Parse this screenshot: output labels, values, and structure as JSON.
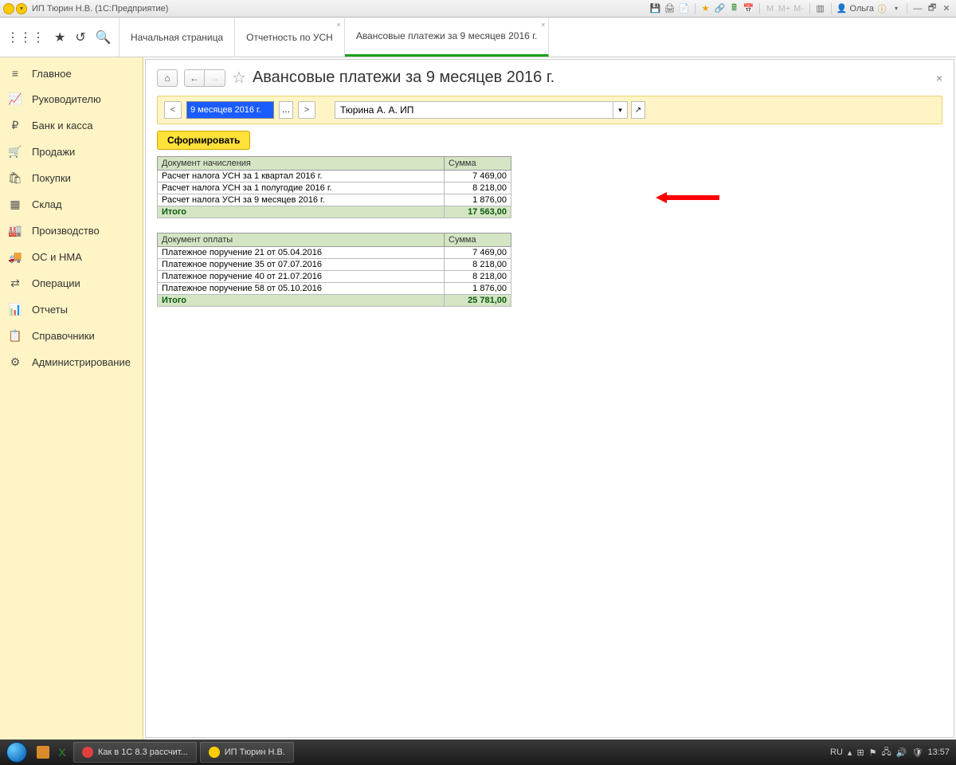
{
  "title": "ИП Тюрин Н.В.  (1С:Предприятие)",
  "user": "Ольга",
  "tabs": [
    {
      "label": "Начальная страница"
    },
    {
      "label": "Отчетность по УСН"
    },
    {
      "label": "Авансовые платежи за 9 месяцев 2016 г."
    }
  ],
  "sidebar": {
    "items": [
      {
        "label": "Главное",
        "icon": "≡"
      },
      {
        "label": "Руководителю",
        "icon": "📈"
      },
      {
        "label": "Банк и касса",
        "icon": "₽"
      },
      {
        "label": "Продажи",
        "icon": "🛒"
      },
      {
        "label": "Покупки",
        "icon": "🛍"
      },
      {
        "label": "Склад",
        "icon": "▦"
      },
      {
        "label": "Производство",
        "icon": "🏭"
      },
      {
        "label": "ОС и НМА",
        "icon": "🚚"
      },
      {
        "label": "Операции",
        "icon": "⇄"
      },
      {
        "label": "Отчеты",
        "icon": "📊"
      },
      {
        "label": "Справочники",
        "icon": "📋"
      },
      {
        "label": "Администрирование",
        "icon": "⚙"
      }
    ]
  },
  "page": {
    "title": "Авансовые платежи за 9 месяцев 2016 г.",
    "period": "9 месяцев 2016 г.",
    "org": "Тюрина А. А. ИП",
    "generate": "Сформировать"
  },
  "table1": {
    "h1": "Документ начисления",
    "h2": "Сумма",
    "rows": [
      {
        "doc": "Расчет налога УСН  за 1 квартал 2016 г.",
        "sum": "7 469,00"
      },
      {
        "doc": "Расчет налога УСН  за 1 полугодие 2016 г.",
        "sum": "8 218,00"
      },
      {
        "doc": "Расчет налога УСН  за 9 месяцев 2016 г.",
        "sum": "1 876,00"
      }
    ],
    "total_label": "Итого",
    "total_sum": "17 563,00"
  },
  "table2": {
    "h1": "Документ оплаты",
    "h2": "Сумма",
    "rows": [
      {
        "doc": "Платежное поручение 21 от 05.04.2016",
        "sum": "7 469,00"
      },
      {
        "doc": "Платежное поручение 35 от 07.07.2016",
        "sum": "8 218,00"
      },
      {
        "doc": "Платежное поручение 40 от 21.07.2016",
        "sum": "8 218,00"
      },
      {
        "doc": "Платежное поручение 58 от 05.10.2016",
        "sum": "1 876,00"
      }
    ],
    "total_label": "Итого",
    "total_sum": "25 781,00"
  },
  "taskbar": {
    "items": [
      {
        "label": "Как в 1С 8.3 рассчит..."
      },
      {
        "label": "ИП Тюрин Н.В."
      }
    ],
    "lang": "RU",
    "time": "13:57"
  }
}
